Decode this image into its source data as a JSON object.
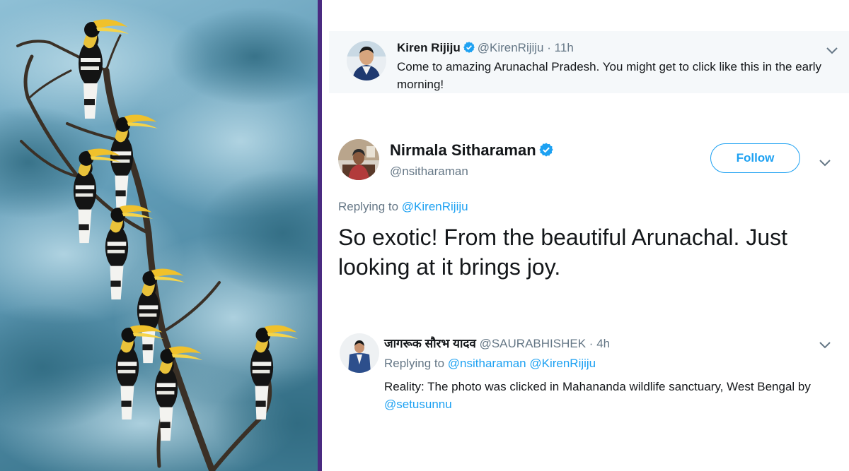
{
  "colors": {
    "accent": "#1da1f2",
    "muted": "#657786",
    "text": "#14171a",
    "divider": "#4a2a80"
  },
  "tweet1": {
    "name": "Kiren Rijiju",
    "handle": "@KirenRijiju",
    "sep": "·",
    "time": "11h",
    "text": "Come to amazing Arunachal Pradesh. You might get to click like this in the early morning!",
    "verified_icon": "verified-badge-icon",
    "menu_icon": "chevron-down-icon"
  },
  "tweet2": {
    "name": "Nirmala Sitharaman",
    "handle": "@nsitharaman",
    "follow_label": "Follow",
    "replying_prefix": "Replying to",
    "replying_to": "@KirenRijiju",
    "text": "So exotic! From the beautiful Arunachal. Just looking at it brings joy.",
    "verified_icon": "verified-badge-icon",
    "menu_icon": "chevron-down-icon"
  },
  "tweet3": {
    "name": "जागरूक सौरभ यादव",
    "handle": "@SAURABHISHEK",
    "sep": "·",
    "time": "4h",
    "replying_prefix": "Replying to",
    "replying_to_1": "@nsitharaman",
    "replying_to_2": "@KirenRijiju",
    "text": "Reality: The photo was clicked in Mahananda wildlife sanctuary, West Bengal by",
    "mention": "@setusunnu",
    "menu_icon": "chevron-down-icon"
  }
}
